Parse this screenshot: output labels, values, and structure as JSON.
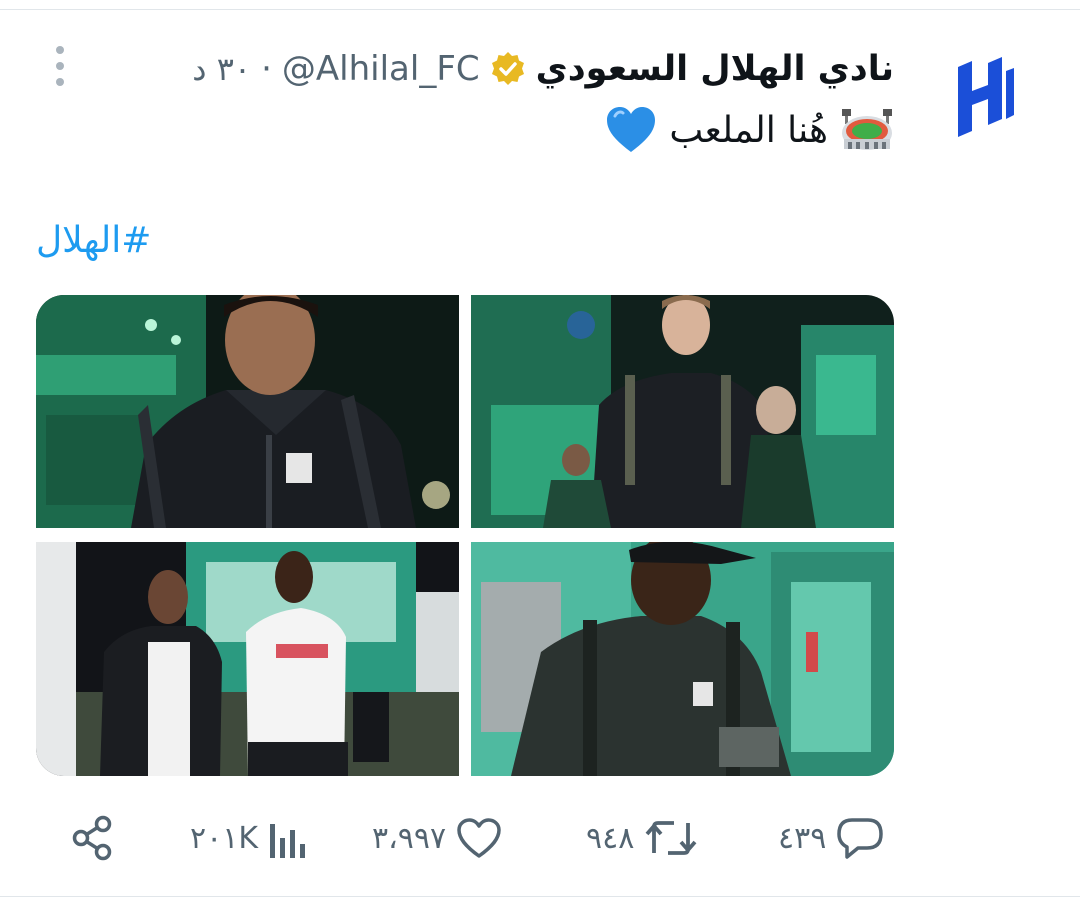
{
  "tweet": {
    "display_name": "نادي الهلال السعودي",
    "handle": "@Alhilal_FC",
    "separator": "·",
    "time": "٣٠ د",
    "text": "هُنا الملعب",
    "emoji_stadium": "stadium-emoji",
    "emoji_heart": "blue-heart-emoji",
    "hashtag": "#الهلال",
    "verified_color": "#e8b923",
    "link_color": "#1d9bf0"
  },
  "media": {
    "count": 4,
    "photos": [
      {
        "label": "photo-1"
      },
      {
        "label": "photo-2"
      },
      {
        "label": "photo-3"
      },
      {
        "label": "photo-4"
      }
    ]
  },
  "actions": {
    "replies": "٤٣٩",
    "retweets": "٩٤٨",
    "likes": "٣،٩٩٧",
    "views": "٢٠١K",
    "icons": [
      "reply-icon",
      "retweet-icon",
      "like-icon",
      "views-icon",
      "share-icon"
    ]
  }
}
